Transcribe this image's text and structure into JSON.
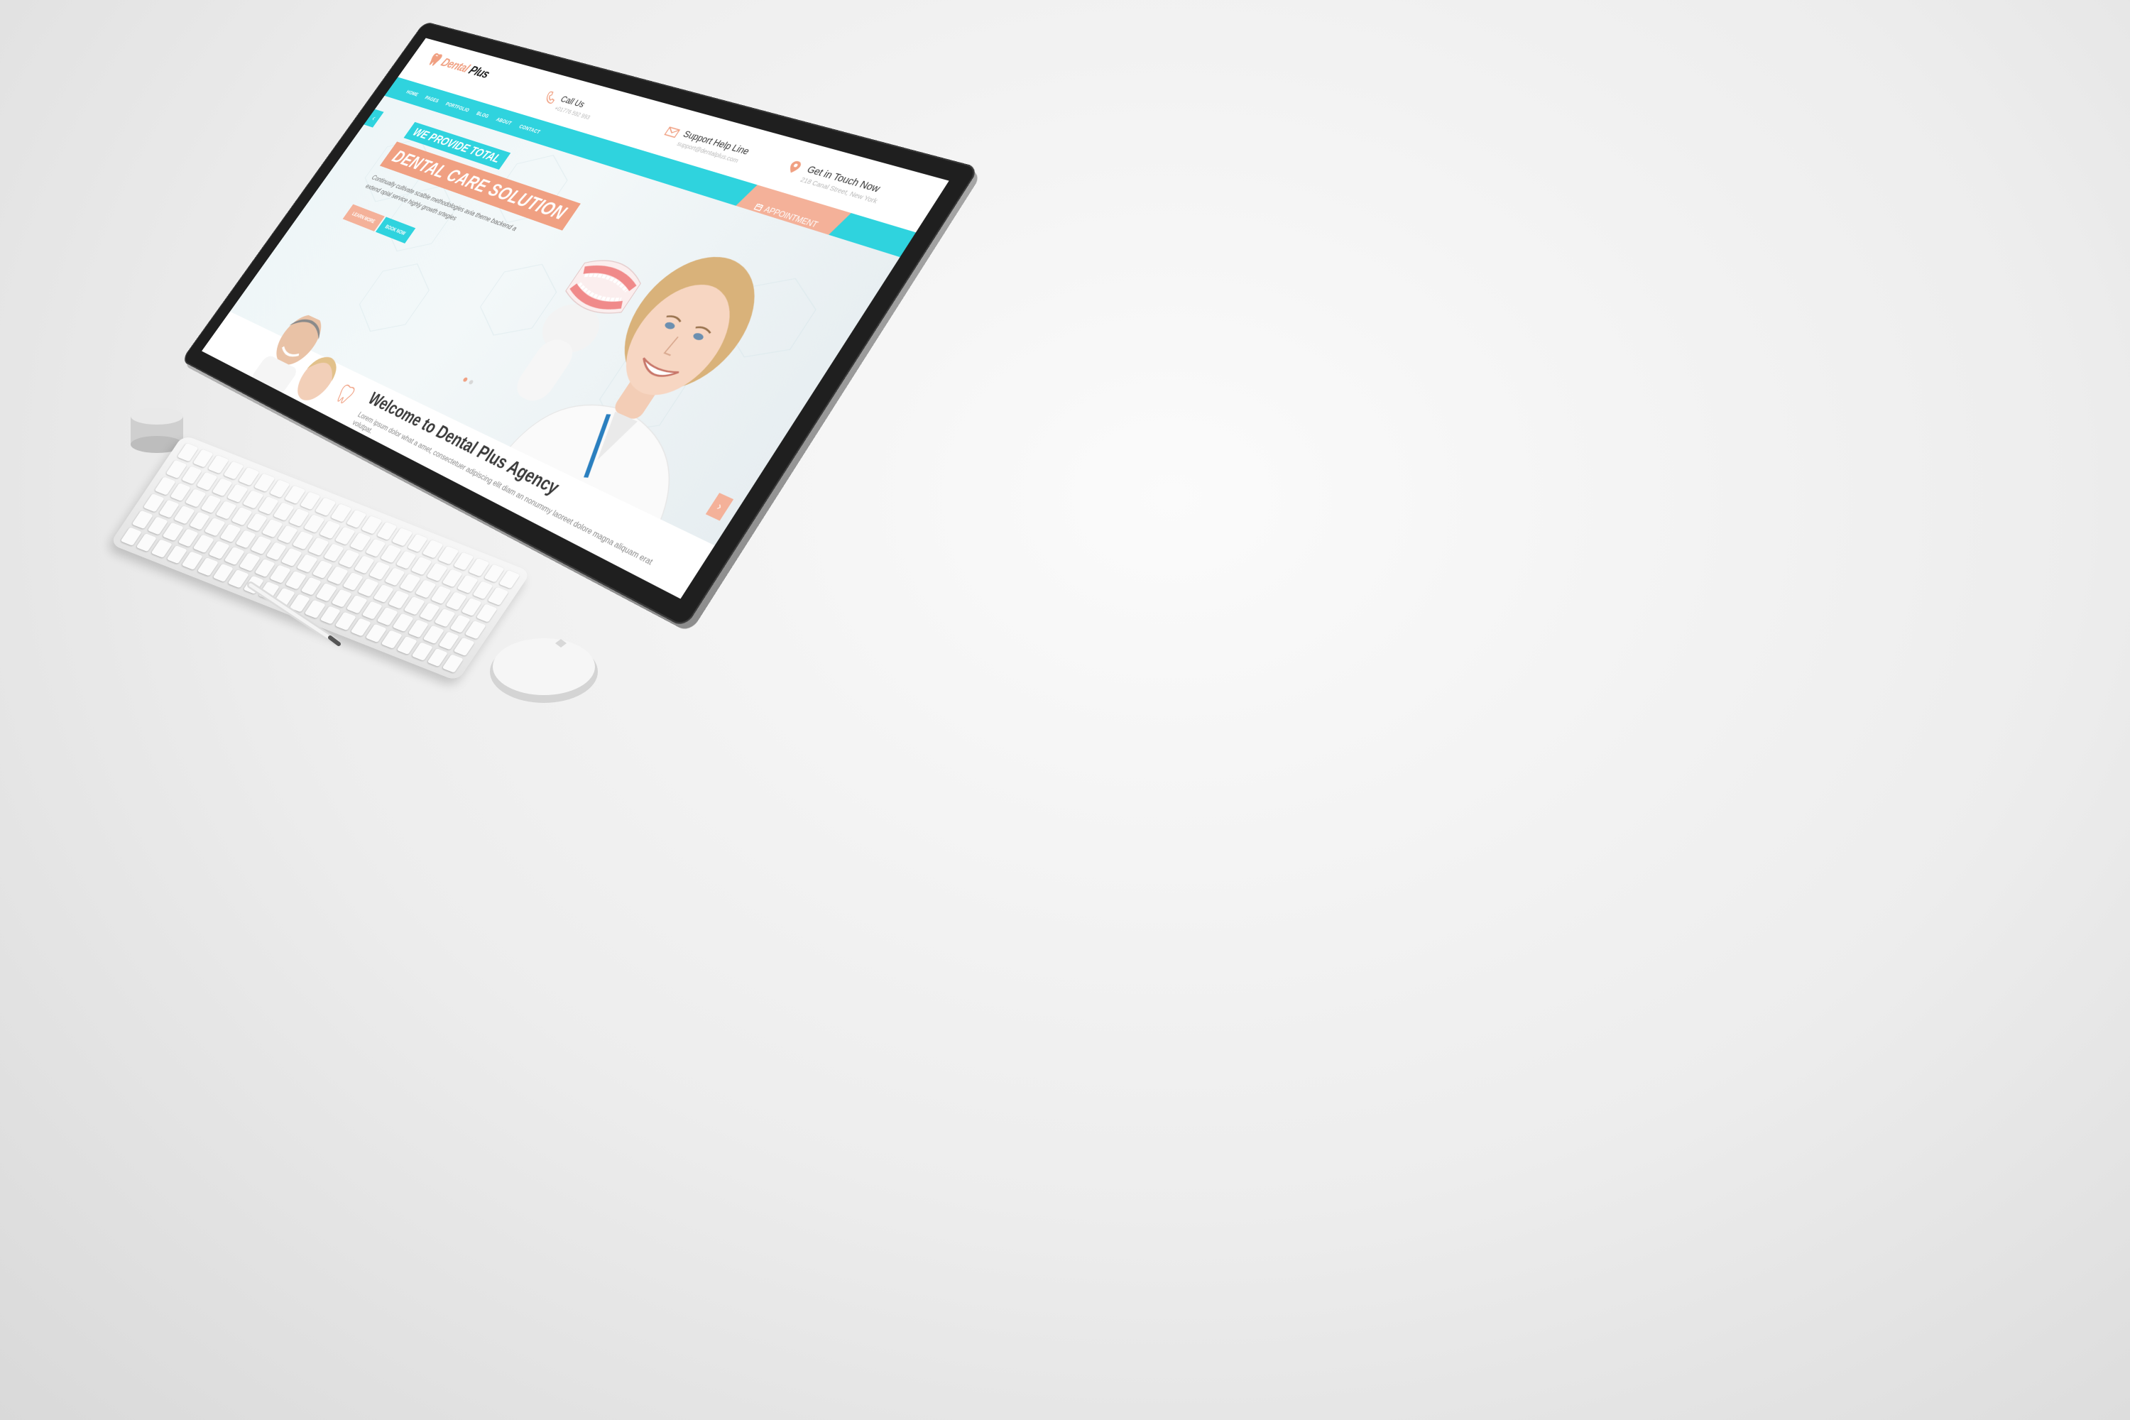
{
  "brand": {
    "name_part1": "Dental",
    "name_part2": "Plus"
  },
  "colors": {
    "accent_teal": "#2fd3de",
    "accent_peach": "#f0a082",
    "peach_light": "#f4b199",
    "text_dark": "#333333"
  },
  "nav": {
    "items": [
      {
        "label": "HOME"
      },
      {
        "label": "PAGES"
      },
      {
        "label": "PORTFOLIO"
      },
      {
        "label": "BLOG"
      },
      {
        "label": "ABOUT"
      },
      {
        "label": "CONTACT"
      }
    ]
  },
  "header_info": {
    "call": {
      "title": "Call Us",
      "detail": "+01776 592 993",
      "icon": "phone-icon"
    },
    "support": {
      "title": "Support Help Line",
      "detail": "support@dentalplus.com",
      "icon": "envelope-icon"
    },
    "touch": {
      "title": "Get in Touch Now",
      "detail": "218 Canal Street, New York",
      "icon": "map-pin-icon"
    }
  },
  "appointment": {
    "label": "APPOINTMENT",
    "icon": "calendar-icon"
  },
  "hero": {
    "tagline_1": "WE PROVIDE TOTAL",
    "tagline_2": "DENTAL CARE SOLUTION",
    "copy": "Continually cultivate scalble methodologies avia theme backend a extend opial service highly growth srtegies",
    "btn_learn": "LEARN MORE",
    "btn_book": "BOOK NOW",
    "prev_label": "‹",
    "next_label": "›",
    "slides_active": 1,
    "slides_total": 2
  },
  "welcome": {
    "title": "Welcome to Dental Plus Agency",
    "text_1": "Lorem ipsum dolor what a amet, consectetuer adipiscing elit diam an nonummy laoreet dolore magna",
    "text_2": "aliquam erat volutpat."
  }
}
